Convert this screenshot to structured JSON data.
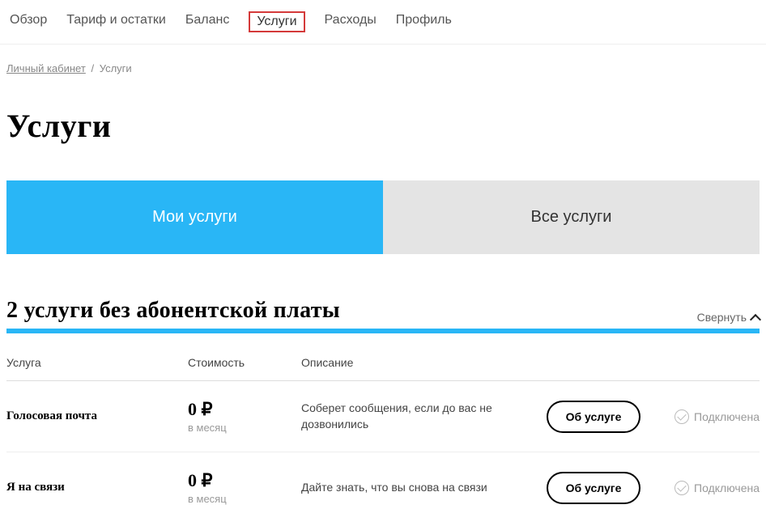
{
  "nav": {
    "items": [
      {
        "label": "Обзор",
        "highlighted": false
      },
      {
        "label": "Тариф и остатки",
        "highlighted": false
      },
      {
        "label": "Баланс",
        "highlighted": false
      },
      {
        "label": "Услуги",
        "highlighted": true
      },
      {
        "label": "Расходы",
        "highlighted": false
      },
      {
        "label": "Профиль",
        "highlighted": false
      }
    ]
  },
  "breadcrumb": {
    "home": "Личный кабинет",
    "sep": "/",
    "current": "Услуги"
  },
  "page_title": "Услуги",
  "tabs": {
    "my": "Мои услуги",
    "all": "Все услуги"
  },
  "section": {
    "title": "2 услуги без абонентской платы",
    "collapse_label": "Свернуть"
  },
  "table": {
    "headers": {
      "name": "Услуга",
      "cost": "Стоимость",
      "desc": "Описание"
    },
    "rows": [
      {
        "name": "Голосовая почта",
        "price": "0 ₽",
        "period": "в месяц",
        "desc": "Соберет сообщения, если до вас не дозвонились",
        "action": "Об услуге",
        "status": "Подключена"
      },
      {
        "name": "Я на связи",
        "price": "0 ₽",
        "period": "в месяц",
        "desc": "Дайте знать, что вы снова на связи",
        "action": "Об услуге",
        "status": "Подключена"
      }
    ]
  }
}
